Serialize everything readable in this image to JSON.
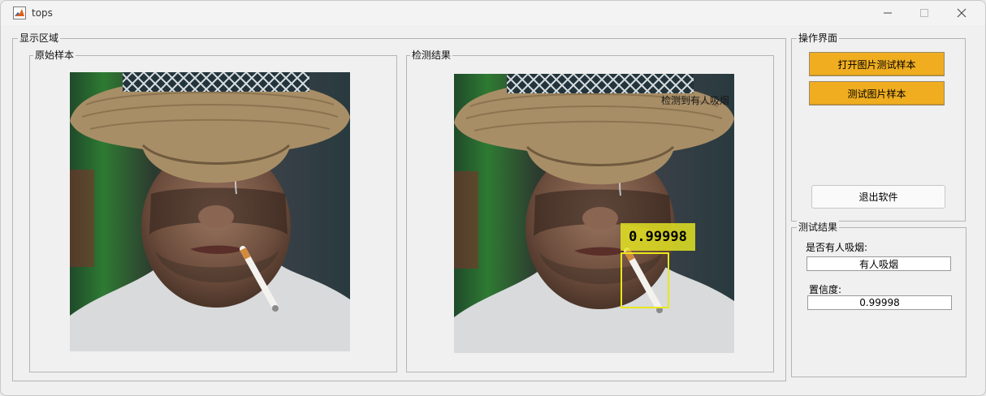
{
  "window": {
    "title": "tops"
  },
  "display": {
    "group_label": "显示区域",
    "original": {
      "label": "原始样本"
    },
    "result": {
      "label": "检测结果",
      "overlay_text": "检测到有人吸烟",
      "detection_score": "0.99998"
    }
  },
  "operations": {
    "group_label": "操作界面",
    "open_button": "打开图片测试样本",
    "test_button": "测试图片样本",
    "exit_button": "退出软件"
  },
  "test_result": {
    "group_label": "测试结果",
    "smoking_label": "是否有人吸烟:",
    "smoking_value": "有人吸烟",
    "confidence_label": "置信度:",
    "confidence_value": "0.99998"
  },
  "colors": {
    "accent_button": "#efad1f",
    "detection_box": "#e8e81a"
  }
}
